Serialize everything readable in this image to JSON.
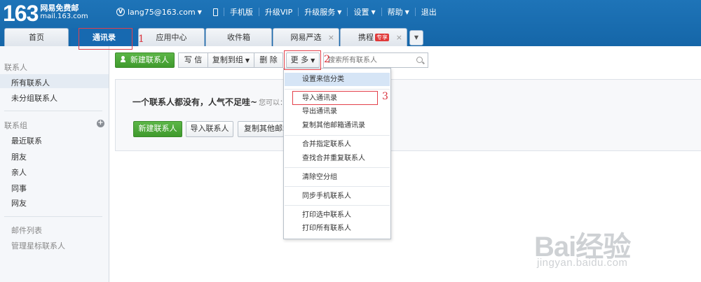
{
  "logo": {
    "number": "163",
    "name": "网易免费邮",
    "domain": "mail.163.com"
  },
  "topnav": {
    "account": "lang75@163.com",
    "mobile": "手机版",
    "upgrade_vip": "升级VIP",
    "upgrade_service": "升级服务",
    "settings": "设置",
    "help": "帮助",
    "logout": "退出"
  },
  "tabs": [
    {
      "label": "首页"
    },
    {
      "label": "通讯录"
    },
    {
      "label": "应用中心"
    },
    {
      "label": "收件箱"
    },
    {
      "label": "网易严选"
    },
    {
      "label": "携程",
      "badge": "专享"
    }
  ],
  "sidebar": {
    "contacts_section": "联系人",
    "all_contacts": "所有联系人",
    "ungrouped": "未分组联系人",
    "groups_section": "联系组",
    "groups": [
      "最近联系",
      "朋友",
      "亲人",
      "同事",
      "网友"
    ],
    "mail_list_section": "邮件列表",
    "starred": "管理星标联系人"
  },
  "toolbar": {
    "new_contact": "新建联系人",
    "write": "写 信",
    "copy_to_group": "复制到组",
    "delete": "删 除",
    "more": "更 多",
    "search_placeholder": "搜索所有联系人"
  },
  "empty_state": {
    "message": "一个联系人都没有，人气不足哇~",
    "hint": "您可以：",
    "new_contact": "新建联系人",
    "import_contacts": "导入联系人",
    "copy_other": "复制其他邮箱"
  },
  "more_menu": {
    "items": [
      "设置来信分类",
      "导入通讯录",
      "导出通讯录",
      "复制其他邮箱通讯录",
      "合并指定联系人",
      "查找合并重复联系人",
      "清除空分组",
      "同步手机联系人",
      "打印选中联系人",
      "打印所有联系人"
    ]
  },
  "annotations": {
    "one": "1",
    "two": "2",
    "three": "3"
  },
  "watermark": {
    "main": "Bai经验",
    "sub": "jingyan.baidu.com"
  },
  "colors": {
    "header_blue": "#1769b0",
    "primary_green": "#4ba938",
    "annotation_red": "#e3404a",
    "menu_highlight": "#d6e5f6"
  }
}
